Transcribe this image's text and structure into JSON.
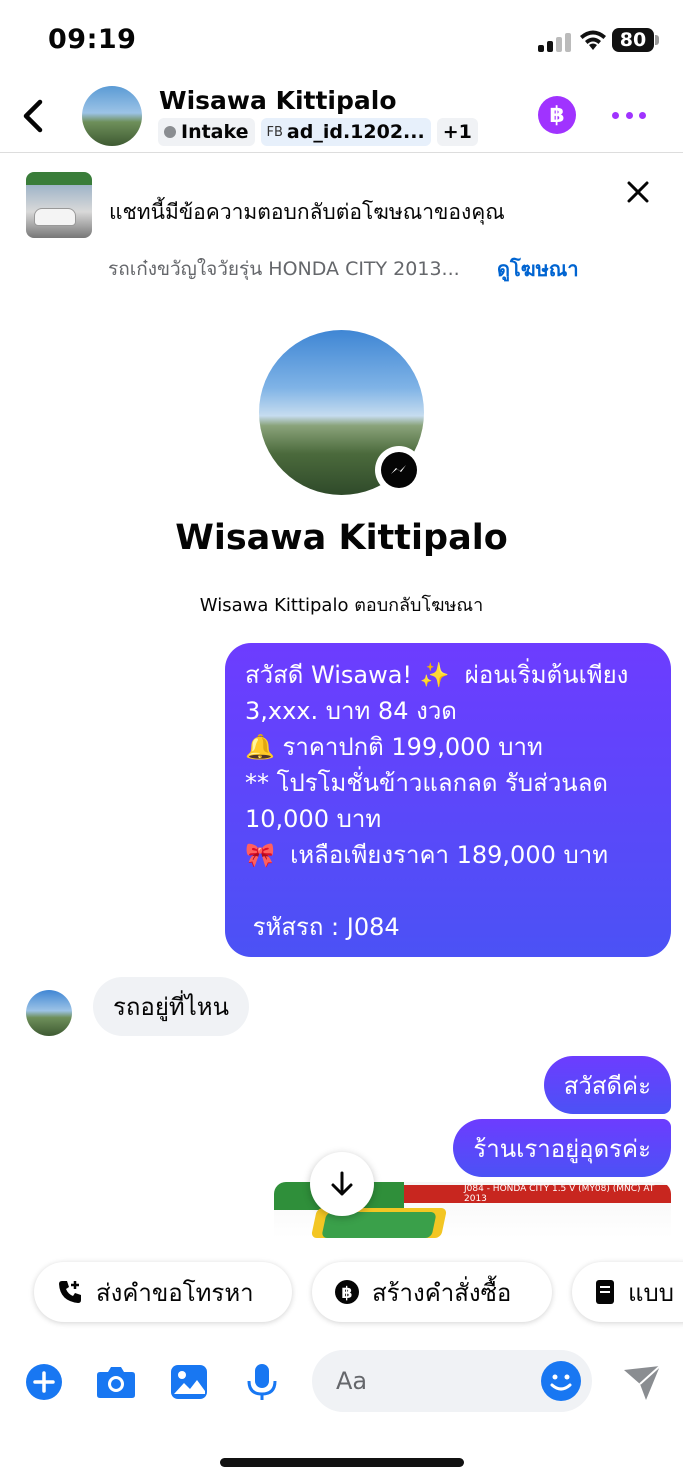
{
  "status_bar": {
    "time": "09:19",
    "battery": "80"
  },
  "header": {
    "name": "Wisawa Kittipalo",
    "chip_intake": "Intake",
    "chip_ad_prefix": "FB",
    "chip_ad": "ad_id.1202...",
    "chip_more": "+1"
  },
  "ad_banner": {
    "title": "แชทนี้มีข้อความตอบกลับต่อโฆษณาของคุณ",
    "subtitle": "รถเก๋งขวัญใจวัยรุ่น HONDA CITY 2013...",
    "link": "ดูโฆษณา"
  },
  "profile": {
    "name": "Wisawa Kittipalo",
    "subtitle": "Wisawa Kittipalo ตอบกลับโฆษณา"
  },
  "messages": {
    "outgoing_1": [
      "สวัสดี Wisawa! ✨  ผ่อนเริ่มต้นเพียง",
      "3,xxx. บาท 84 งวด",
      "🔔 ราคาปกติ 199,000 บาท",
      "** โปรโมชั่นข้าวแลกลด รับส่วนลด",
      "10,000 บาท",
      "🎀  เหลือเพียงราคา 189,000 บาท",
      "",
      " รหัสรถ : J084"
    ],
    "incoming_1": "รถอยู่ที่ไหน",
    "outgoing_2": "สวัสดีค่ะ",
    "outgoing_3": "ร้านเราอยู่อุดรค่ะ",
    "image_caption": "J084 - HONDA CITY 1.5 V (MY08) (MNC) AT 2013"
  },
  "quick_actions": [
    {
      "label": "ส่งคำขอโทรหา",
      "icon": "phone-plus-icon"
    },
    {
      "label": "สร้างคำสั่งซื้อ",
      "icon": "baht-icon"
    },
    {
      "label": "แบบ",
      "icon": "document-icon"
    }
  ],
  "composer": {
    "placeholder": "Aa"
  },
  "colors": {
    "accent": "#a033ff",
    "bubble_start": "#6d3cff",
    "bubble_end": "#4b52f5",
    "link": "#0064d1",
    "icon_blue": "#1877f2"
  }
}
